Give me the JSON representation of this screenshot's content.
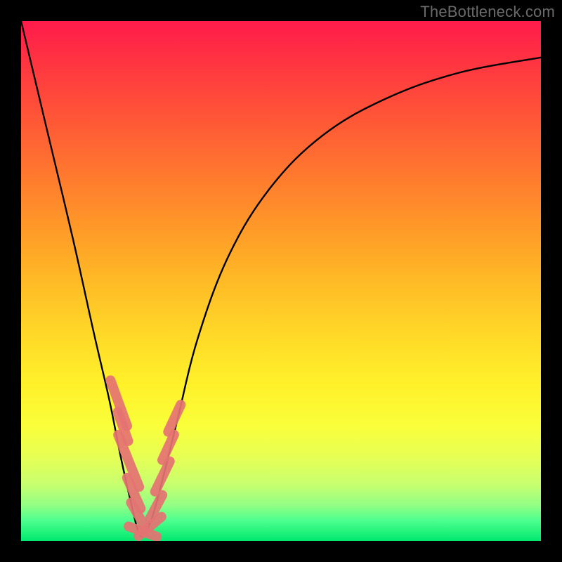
{
  "watermark": "TheBottleneck.com",
  "chart_data": {
    "type": "line",
    "title": "",
    "xlabel": "",
    "ylabel": "",
    "xlim": [
      0,
      100
    ],
    "ylim": [
      0,
      100
    ],
    "grid": false,
    "background_gradient": {
      "top": "#ff1b4b",
      "middle": "#ffd828",
      "bottom": "#00e96f"
    },
    "series": [
      {
        "name": "bottleneck-curve",
        "note": "V-shaped notch; values approximate % height from bottom (0 = bottom, 100 = top). Minimum near x≈23.",
        "x": [
          0,
          5,
          10,
          14,
          17,
          19,
          21,
          23,
          25,
          27,
          30,
          34,
          40,
          48,
          58,
          70,
          84,
          100
        ],
        "values": [
          100,
          79,
          58,
          40,
          27,
          17,
          8,
          1,
          4,
          11,
          23,
          39,
          55,
          68,
          78,
          85,
          90,
          93
        ]
      }
    ],
    "markers": {
      "name": "salmon-dash-markers",
      "note": "Short pill-shaped salmon markers overlaid along both legs near the minimum.",
      "color": "#e57373",
      "segments": [
        {
          "x": 18.8,
          "y": 26.5,
          "angle": -70,
          "len": 5.2
        },
        {
          "x": 19.6,
          "y": 22.0,
          "angle": -70,
          "len": 3.3
        },
        {
          "x": 20.7,
          "y": 15.4,
          "angle": -68,
          "len": 6.0
        },
        {
          "x": 21.7,
          "y": 9.2,
          "angle": -66,
          "len": 3.6
        },
        {
          "x": 22.4,
          "y": 5.2,
          "angle": -60,
          "len": 2.8
        },
        {
          "x": 23.4,
          "y": 1.8,
          "angle": -20,
          "len": 3.2
        },
        {
          "x": 24.8,
          "y": 2.8,
          "angle": 40,
          "len": 3.2
        },
        {
          "x": 26.0,
          "y": 6.6,
          "angle": 62,
          "len": 2.8
        },
        {
          "x": 27.2,
          "y": 12.4,
          "angle": 64,
          "len": 3.6
        },
        {
          "x": 28.3,
          "y": 18.0,
          "angle": 65,
          "len": 3.0
        },
        {
          "x": 29.5,
          "y": 23.6,
          "angle": 65,
          "len": 3.2
        }
      ]
    }
  }
}
